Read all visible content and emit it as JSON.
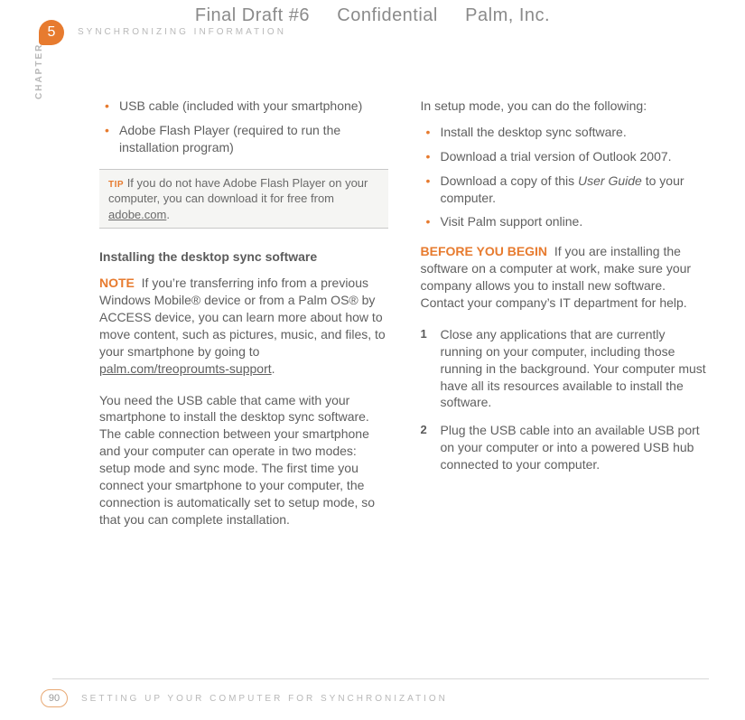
{
  "header": {
    "draft": "Final Draft #6",
    "confidential": "Confidential",
    "company": "Palm, Inc."
  },
  "chapter": {
    "num": "5",
    "side": "CHAPTER",
    "top_section": "SYNCHRONIZING INFORMATION"
  },
  "left": {
    "bullets": [
      "USB cable (included with your smartphone)",
      "Adobe Flash Player (required to run the installation program)"
    ],
    "tip": {
      "label": "TIP",
      "before_link": "If you do not have Adobe Flash Player on your computer, you can download it for free from ",
      "link": "adobe.com",
      "after_link": "."
    },
    "subhead": "Installing the desktop sync software",
    "note": {
      "label": "NOTE",
      "before_link": "If you’re transferring info from a previous Windows Mobile® device or from a Palm OS® by ACCESS device, you can learn more about how to move content, such as pictures, music, and files, to your smartphone by going to ",
      "link": "palm.com/treoproumts-support",
      "after_link": "."
    },
    "para": "You need the USB cable that came with your smartphone to install the desktop sync software. The cable connection between your smartphone and your computer can operate in two modes: setup mode and sync mode. The first time you connect your smartphone to your computer, the connection is automatically set to setup mode, so that you can complete installation."
  },
  "right": {
    "intro": "In setup mode, you can do the following:",
    "bullets_head": "Install the desktop sync software.",
    "bullets": [
      "Install the desktop sync software.",
      "Download a trial version of Outlook 2007."
    ],
    "bullet3_pre": "Download a copy of this ",
    "bullet3_italic": "User Guide",
    "bullet3_post": " to your computer.",
    "bullet4": "Visit Palm support online.",
    "before": {
      "label": "BEFORE YOU BEGIN",
      "text": "If you are installing the software on a computer at work, make sure your company allows you to install new software. Contact your company’s IT department for help."
    },
    "steps": [
      {
        "n": "1",
        "t": "Close any applications that are currently running on your computer, including those running in the background. Your computer must have all its resources available to install the software."
      },
      {
        "n": "2",
        "t": "Plug the USB cable into an available USB port on your computer or into a powered USB hub connected to your computer."
      }
    ]
  },
  "footer": {
    "page": "90",
    "label": "SETTING UP YOUR COMPUTER FOR SYNCHRONIZATION"
  }
}
